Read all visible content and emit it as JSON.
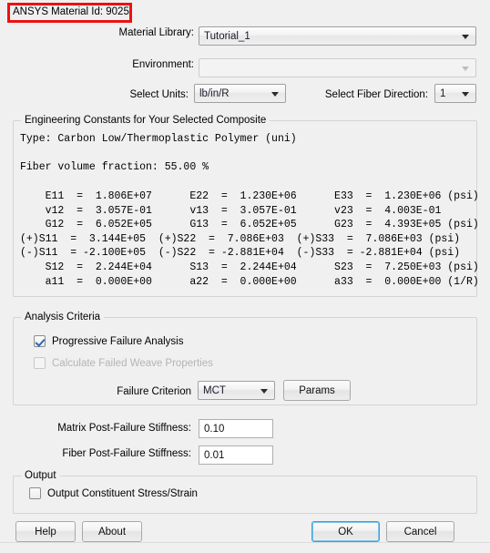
{
  "annotation": {
    "label": "ANSYS Material Id: 9025",
    "box_color": "#ee1111"
  },
  "form": {
    "material_library": {
      "label": "Material Library:",
      "value": "Tutorial_1",
      "options": [
        "Tutorial_1"
      ]
    },
    "environment": {
      "label": "Environment:",
      "value": "",
      "placeholder": "",
      "disabled": true
    },
    "select_units": {
      "label": "Select Units:",
      "value": "lb/in/R",
      "options": [
        "lb/in/R"
      ]
    },
    "select_fiber_direction": {
      "label": "Select Fiber Direction:",
      "value": "1",
      "options": [
        "1"
      ]
    }
  },
  "constants_group": {
    "legend": "Engineering Constants for Your Selected Composite",
    "type_line": "Type: Carbon Low/Thermoplastic Polymer (uni)",
    "fiber_volume_line": "Fiber volume fraction: 55.00 %",
    "body": "    E11  =  1.806E+07      E22  =  1.230E+06      E33  =  1.230E+06 (psi)\n    v12  =  3.057E-01      v13  =  3.057E-01      v23  =  4.003E-01\n    G12  =  6.052E+05      G13  =  6.052E+05      G23  =  4.393E+05 (psi)\n(+)S11  =  3.144E+05  (+)S22  =  7.086E+03  (+)S33  =  7.086E+03 (psi)\n(-)S11  = -2.100E+05  (-)S22  = -2.881E+04  (-)S33  = -2.881E+04 (psi)\n    S12  =  2.244E+04      S13  =  2.244E+04      S23  =  7.250E+03 (psi)\n    a11  =  0.000E+00      a22  =  0.000E+00      a33  =  0.000E+00 (1/R)"
  },
  "analysis_criteria": {
    "legend": "Analysis Criteria",
    "progressive_failure_analysis": {
      "label": "Progressive Failure Analysis",
      "checked": true,
      "disabled": false
    },
    "calculate_failed_weave_properties": {
      "label": "Calculate Failed Weave Properties",
      "checked": false,
      "disabled": true
    },
    "failure_criterion": {
      "label": "Failure Criterion",
      "value": "MCT",
      "options": [
        "MCT"
      ]
    },
    "params_button": "Params"
  },
  "stiffness": {
    "matrix": {
      "label": "Matrix Post-Failure Stiffness:",
      "value": "0.10"
    },
    "fiber": {
      "label": "Fiber Post-Failure Stiffness:",
      "value": "0.01"
    }
  },
  "output_group": {
    "legend": "Output",
    "output_constituent": {
      "label": "Output Constituent Stress/Strain",
      "checked": false
    }
  },
  "footer": {
    "help": "Help",
    "about": "About",
    "ok": "OK",
    "cancel": "Cancel"
  }
}
